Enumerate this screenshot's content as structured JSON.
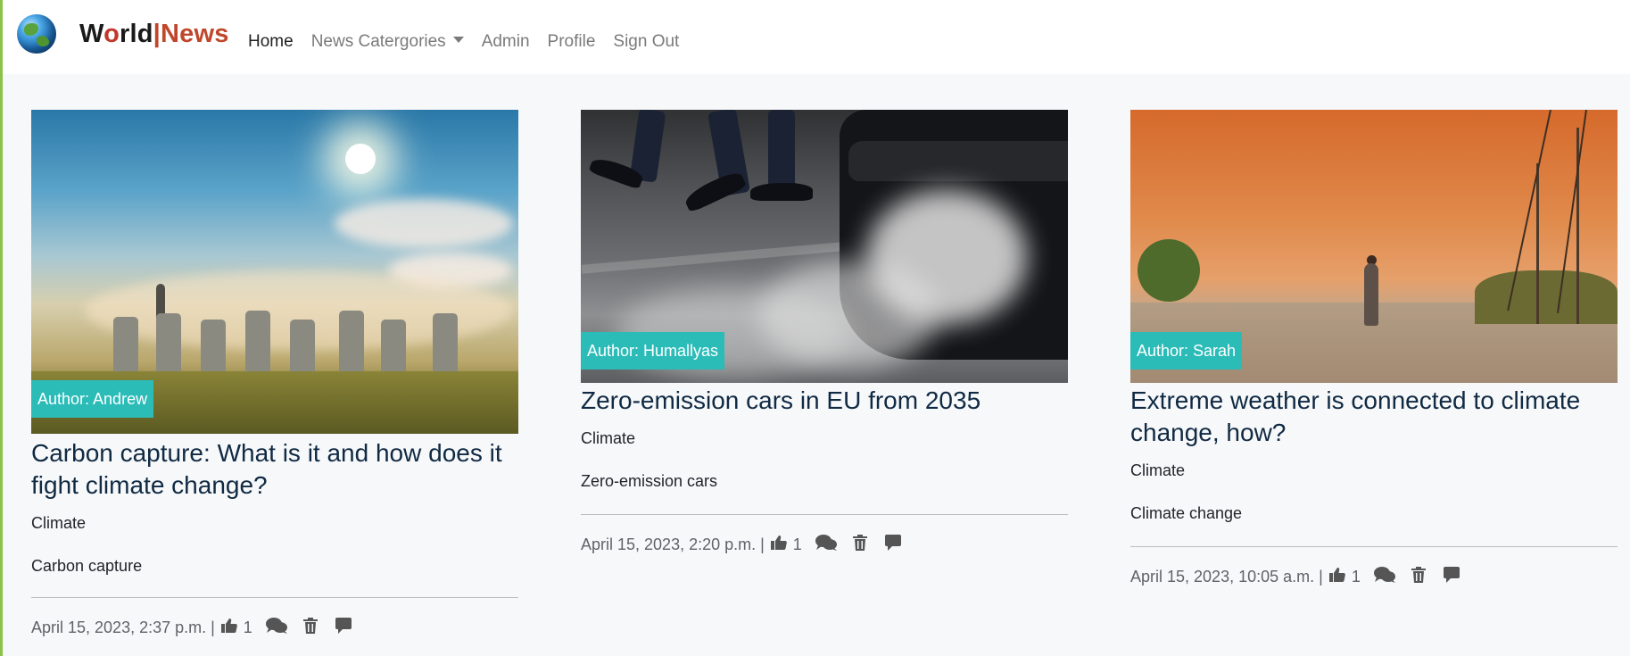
{
  "brand": {
    "part1": "W",
    "part2": "o",
    "part3": "rld",
    "separator": "|",
    "part4": "News"
  },
  "nav": {
    "home": "Home",
    "categories": "News Catergories",
    "admin": "Admin",
    "profile": "Profile",
    "signout": "Sign Out"
  },
  "colors": {
    "accent_badge": "#2bbcb8",
    "brand_red": "#c0472b",
    "title": "#102a43"
  },
  "articles": [
    {
      "author": "Author: Andrew",
      "title": "Carbon capture: What is it and how does it fight climate change?",
      "category": "Climate",
      "tag": "Carbon capture",
      "date": "April 15, 2023, 2:37 p.m. |",
      "likes": "1",
      "icons": [
        "thumbs-up-icon",
        "comments-icon",
        "trash-icon",
        "comment-icon"
      ]
    },
    {
      "author": "Author: Humallyas",
      "title": "Zero-emission cars in EU from 2035",
      "category": "Climate",
      "tag": "Zero-emission cars",
      "date": "April 15, 2023, 2:20 p.m. |",
      "likes": "1",
      "icons": [
        "thumbs-up-icon",
        "comments-icon",
        "trash-icon",
        "comment-icon"
      ]
    },
    {
      "author": "Author: Sarah",
      "title": "Extreme weather is connected to climate change, how?",
      "category": "Climate",
      "tag": "Climate change",
      "date": "April 15, 2023, 10:05 a.m. |",
      "likes": "1",
      "icons": [
        "thumbs-up-icon",
        "comments-icon",
        "trash-icon",
        "comment-icon"
      ]
    }
  ]
}
